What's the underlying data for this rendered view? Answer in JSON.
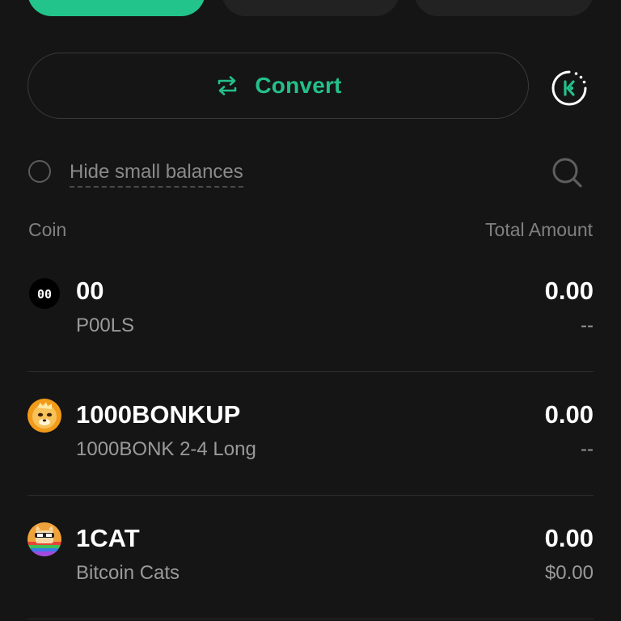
{
  "tabs": [
    {
      "label": "",
      "active": true
    },
    {
      "label": "",
      "active": false
    },
    {
      "label": "",
      "active": false
    }
  ],
  "convert": {
    "label": "Convert",
    "accent_color": "#24c08a",
    "icon": "swap-arrows-icon"
  },
  "history_icon": "kucoin-history-icon",
  "filter": {
    "hide_small_label": "Hide small balances",
    "checked": false,
    "search_icon": "search-icon"
  },
  "columns": {
    "coin": "Coin",
    "total": "Total Amount"
  },
  "coins": [
    {
      "symbol": "00",
      "name": "P00LS",
      "amount": "0.00",
      "value": "--",
      "logo_text": "00",
      "icon": "pools-logo-icon"
    },
    {
      "symbol": "1000BONKUP",
      "name": "1000BONK 2-4 Long",
      "amount": "0.00",
      "value": "--",
      "icon": "bonk-logo-icon"
    },
    {
      "symbol": "1CAT",
      "name": "Bitcoin Cats",
      "amount": "0.00",
      "value": "$0.00",
      "icon": "bitcoin-cats-logo-icon"
    }
  ]
}
